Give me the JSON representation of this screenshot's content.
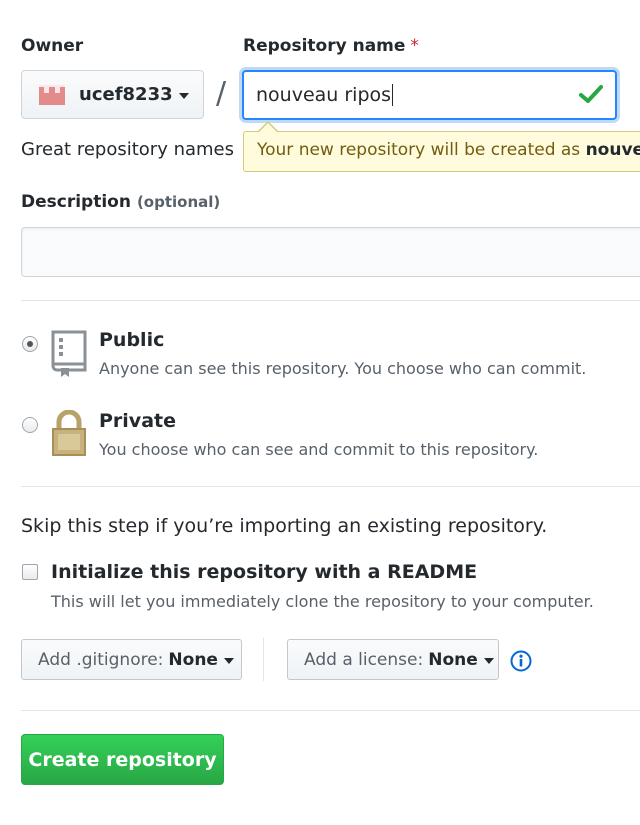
{
  "owner": {
    "label": "Owner",
    "username": "ucef8233"
  },
  "repo_name": {
    "label": "Repository name",
    "required_mark": "*",
    "value": "nouveau ripos"
  },
  "hint_text": "Great repository names",
  "tooltip": {
    "prefix": "Your new repository will be created as",
    "name": "nouve"
  },
  "description": {
    "label": "Description",
    "optional": "(optional)",
    "value": ""
  },
  "visibility": {
    "public": {
      "title": "Public",
      "description": "Anyone can see this repository. You choose who can commit.",
      "selected": true
    },
    "private": {
      "title": "Private",
      "description": "You choose who can see and commit to this repository.",
      "selected": false
    }
  },
  "skip_text": "Skip this step if you’re importing an existing repository.",
  "readme": {
    "title": "Initialize this repository with a README",
    "description": "This will let you immediately clone the repository to your computer.",
    "checked": false
  },
  "gitignore": {
    "prefix": "Add .gitignore:",
    "value": "None"
  },
  "license": {
    "prefix": "Add a license:",
    "value": "None"
  },
  "create_button": "Create repository",
  "icons": {
    "owner_avatar": "identicon-avatar",
    "valid": "check-icon",
    "public": "repo-book-icon",
    "private": "lock-icon",
    "info": "info-icon"
  },
  "colors": {
    "focus": "#2188ff",
    "valid_check": "#28a745",
    "tooltip_bg": "#fffbdd",
    "create_button": "#28a745",
    "required": "#cb2431",
    "info": "#0366d6"
  }
}
